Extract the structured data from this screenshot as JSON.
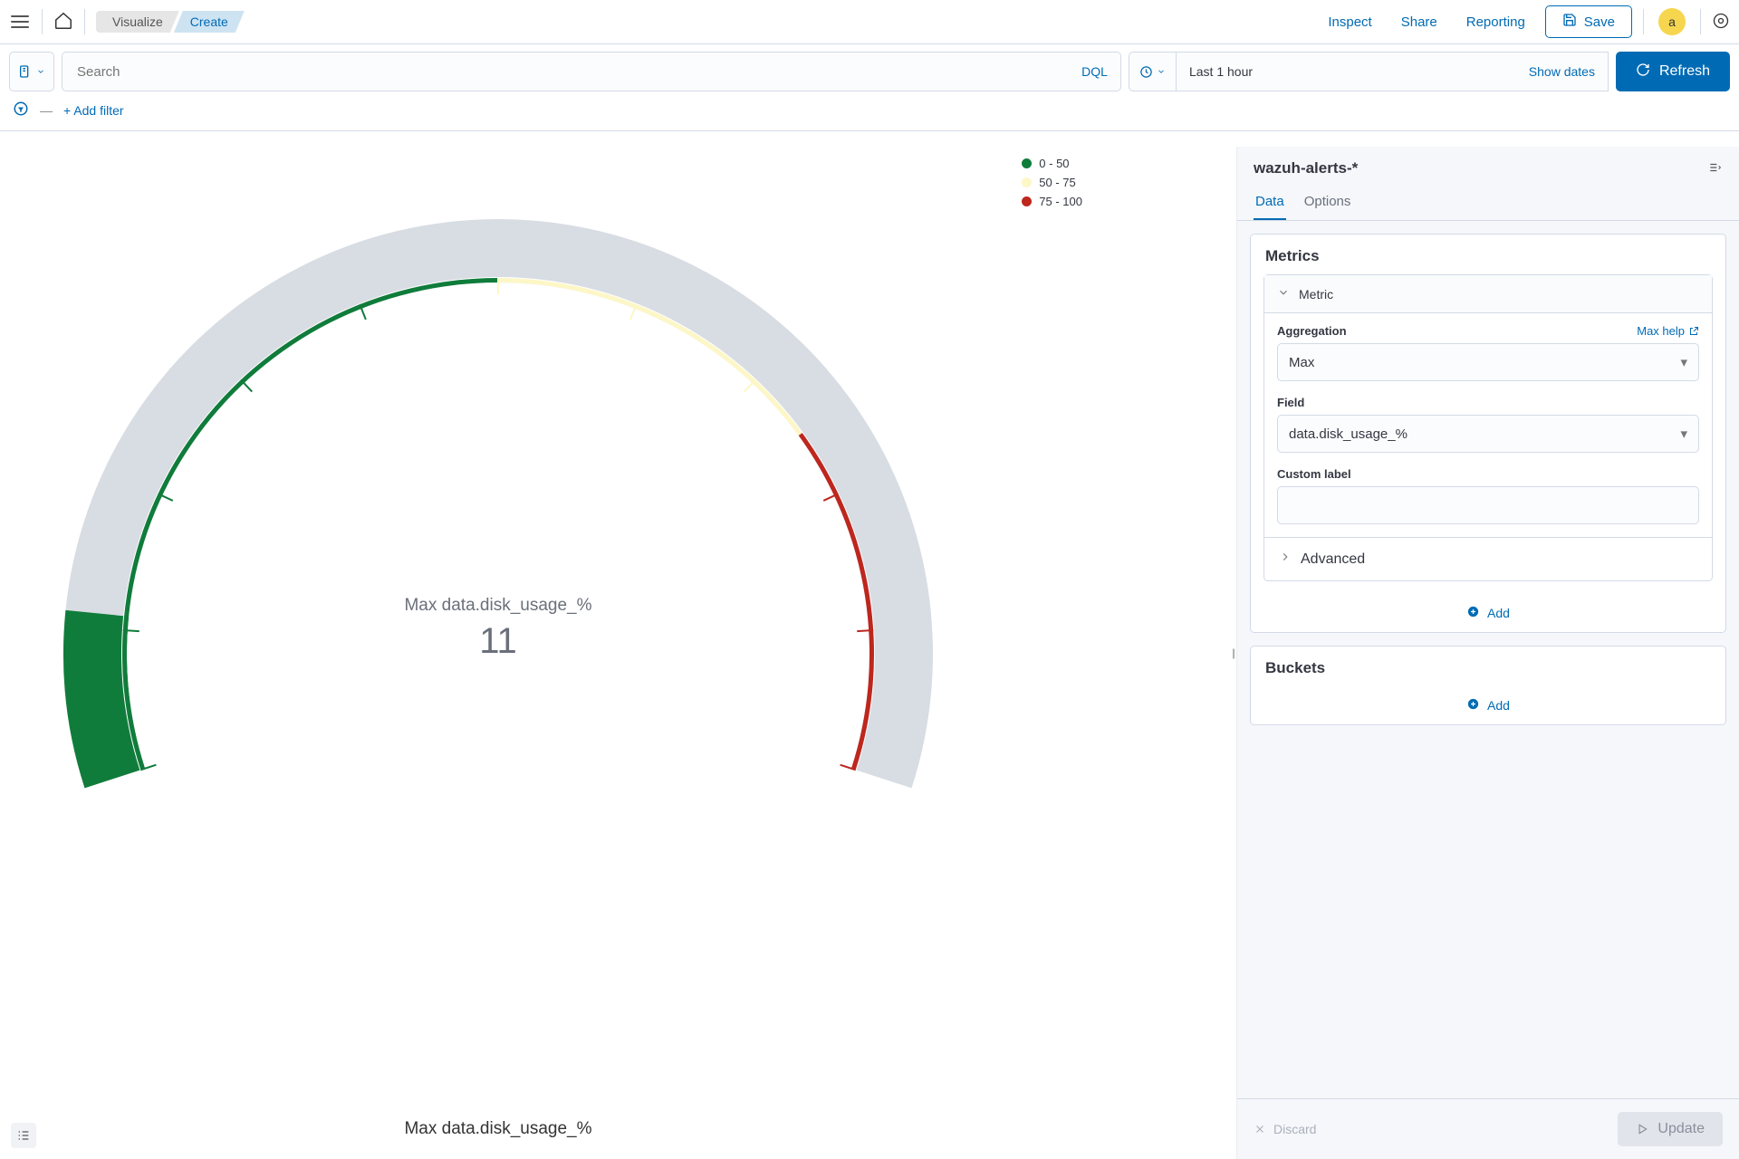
{
  "header": {
    "breadcrumbs": [
      "Visualize",
      "Create"
    ],
    "links": [
      "Inspect",
      "Share",
      "Reporting"
    ],
    "save_label": "Save",
    "avatar": "a"
  },
  "querybar": {
    "search_placeholder": "Search",
    "dql_label": "DQL",
    "time_range": "Last 1 hour",
    "show_dates": "Show dates",
    "refresh_label": "Refresh"
  },
  "filterbar": {
    "add_filter": "+ Add filter"
  },
  "chart_data": {
    "type": "gauge",
    "title": "Max data.disk_usage_%",
    "value": 11,
    "min": 0,
    "max": 100,
    "start_angle_deg": -108,
    "end_angle_deg": 108,
    "ranges": [
      {
        "label": "0 - 50",
        "from": 0,
        "to": 50,
        "color": "#107c3b"
      },
      {
        "label": "50 - 75",
        "from": 50,
        "to": 75,
        "color": "#fdf7c7"
      },
      {
        "label": "75 - 100",
        "from": 75,
        "to": 100,
        "color": "#bd271e"
      }
    ],
    "bottom_label": "Max data.disk_usage_%"
  },
  "sidebar": {
    "index_pattern": "wazuh-alerts-*",
    "tabs": [
      "Data",
      "Options"
    ],
    "active_tab": 0,
    "metrics": {
      "title": "Metrics",
      "metric_label": "Metric",
      "aggregation_label": "Aggregation",
      "aggregation_help": "Max help",
      "aggregation_value": "Max",
      "field_label": "Field",
      "field_value": "data.disk_usage_%",
      "custom_label_label": "Custom label",
      "custom_label_value": "",
      "advanced_label": "Advanced",
      "add_label": "Add"
    },
    "buckets": {
      "title": "Buckets",
      "add_label": "Add"
    },
    "footer": {
      "discard": "Discard",
      "update": "Update"
    }
  }
}
